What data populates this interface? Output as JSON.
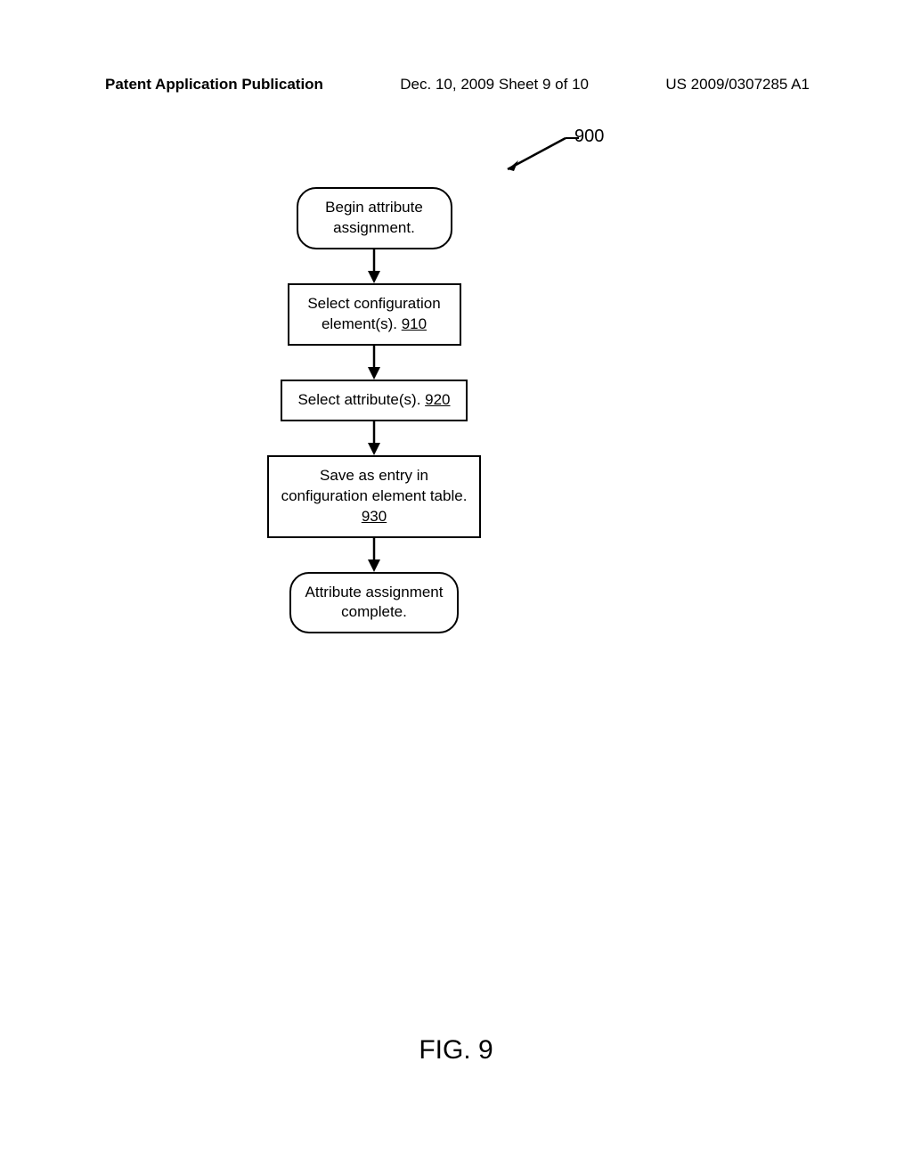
{
  "header": {
    "left": "Patent Application Publication",
    "center": "Dec. 10, 2009  Sheet 9 of 10",
    "right": "US 2009/0307285 A1"
  },
  "diagram": {
    "label": "900",
    "figure_label": "FIG. 9",
    "boxes": {
      "start": "Begin attribute assignment.",
      "step1_text": "Select configuration element(s). ",
      "step1_ref": "910",
      "step2_text": "Select attribute(s). ",
      "step2_ref": "920",
      "step3_line1": "Save as entry in",
      "step3_line2": "configuration element table.",
      "step3_ref": "930",
      "end": "Attribute assignment complete."
    }
  },
  "chart_data": {
    "type": "flowchart",
    "title": "FIG. 9",
    "label": "900",
    "nodes": [
      {
        "id": "start",
        "shape": "rounded",
        "text": "Begin attribute assignment."
      },
      {
        "id": "910",
        "shape": "rect",
        "text": "Select configuration element(s). 910"
      },
      {
        "id": "920",
        "shape": "rect",
        "text": "Select attribute(s). 920"
      },
      {
        "id": "930",
        "shape": "rect",
        "text": "Save as entry in configuration element table. 930"
      },
      {
        "id": "end",
        "shape": "rounded",
        "text": "Attribute assignment complete."
      }
    ],
    "edges": [
      {
        "from": "start",
        "to": "910"
      },
      {
        "from": "910",
        "to": "920"
      },
      {
        "from": "920",
        "to": "930"
      },
      {
        "from": "930",
        "to": "end"
      }
    ]
  }
}
